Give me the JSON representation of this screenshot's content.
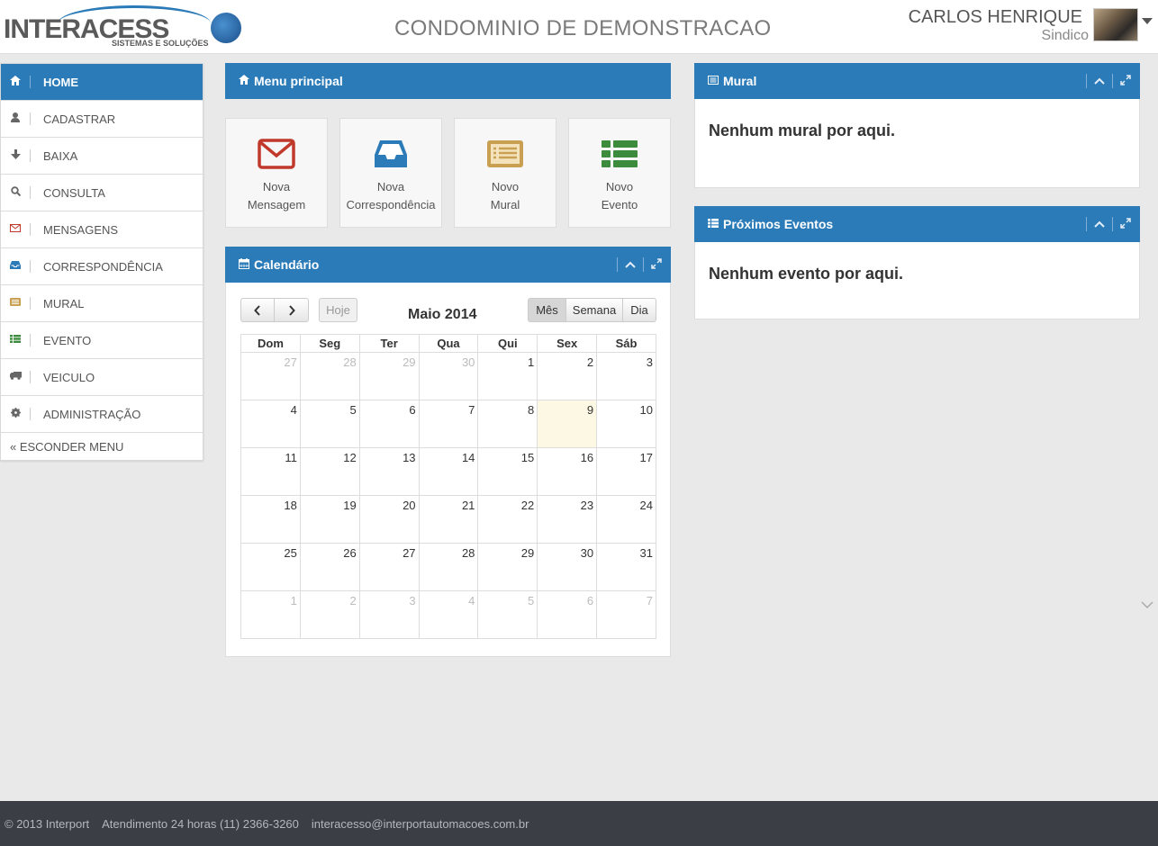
{
  "header": {
    "logo_text": "INTERACESS",
    "logo_subtitle": "SISTEMAS E SOLUÇÕES",
    "title": "CONDOMINIO DE DEMONSTRACAO",
    "user_name": "CARLOS HENRIQUE",
    "user_role": "Sindico"
  },
  "sidebar": {
    "items": [
      {
        "label": "HOME",
        "icon": "home-icon",
        "color": "#ffffff",
        "active": true
      },
      {
        "label": "CADASTRAR",
        "icon": "user-icon",
        "color": "#555555"
      },
      {
        "label": "BAIXA",
        "icon": "arrow-down-icon",
        "color": "#555555"
      },
      {
        "label": "CONSULTA",
        "icon": "search-icon",
        "color": "#555555"
      },
      {
        "label": "MENSAGENS",
        "icon": "envelope-icon",
        "color": "#c0392b"
      },
      {
        "label": "CORRESPONDÊNCIA",
        "icon": "inbox-icon",
        "color": "#2b7bb9"
      },
      {
        "label": "MURAL",
        "icon": "list-alt-icon",
        "color": "#c9a052"
      },
      {
        "label": "EVENTO",
        "icon": "th-list-icon",
        "color": "#3d8b3d"
      },
      {
        "label": "VEICULO",
        "icon": "truck-icon",
        "color": "#555555"
      },
      {
        "label": "ADMINISTRAÇÃO",
        "icon": "cog-icon",
        "color": "#555555"
      }
    ],
    "toggle_label": "« ESCONDER MENU"
  },
  "menu_panel": {
    "title": "Menu principal",
    "tiles": [
      {
        "line1": "Nova",
        "line2": "Mensagem",
        "icon": "envelope-icon",
        "color": "#c0392b"
      },
      {
        "line1": "Nova",
        "line2": "Correspondência",
        "icon": "inbox-icon",
        "color": "#2b7bb9"
      },
      {
        "line1": "Novo",
        "line2": "Mural",
        "icon": "list-alt-icon",
        "color": "#c9a052"
      },
      {
        "line1": "Novo",
        "line2": "Evento",
        "icon": "th-list-icon",
        "color": "#3d8b3d"
      }
    ]
  },
  "calendar": {
    "panel_title": "Calendário",
    "today_label": "Hoje",
    "month_title": "Maio 2014",
    "view_month": "Mês",
    "view_week": "Semana",
    "view_day": "Dia",
    "weekdays": [
      "Dom",
      "Seg",
      "Ter",
      "Qua",
      "Qui",
      "Sex",
      "Sáb"
    ],
    "weeks": [
      [
        "27",
        "28",
        "29",
        "30",
        "1",
        "2",
        "3"
      ],
      [
        "4",
        "5",
        "6",
        "7",
        "8",
        "9",
        "10"
      ],
      [
        "11",
        "12",
        "13",
        "14",
        "15",
        "16",
        "17"
      ],
      [
        "18",
        "19",
        "20",
        "21",
        "22",
        "23",
        "24"
      ],
      [
        "25",
        "26",
        "27",
        "28",
        "29",
        "30",
        "31"
      ],
      [
        "1",
        "2",
        "3",
        "4",
        "5",
        "6",
        "7"
      ]
    ],
    "today": "9"
  },
  "mural_panel": {
    "title": "Mural",
    "empty_message": "Nenhum mural por aqui."
  },
  "events_panel": {
    "title": "Próximos Eventos",
    "empty_message": "Nenhum evento por aqui."
  },
  "footer": {
    "copyright": "© 2013 Interport",
    "support": "Atendimento 24 horas (11) 2366-3260",
    "email": "interacesso@interportautomacoes.com.br"
  },
  "colors": {
    "accent": "#2b7bb9",
    "today_highlight": "#fcf8e3",
    "footer_bg": "#3b3f45"
  }
}
